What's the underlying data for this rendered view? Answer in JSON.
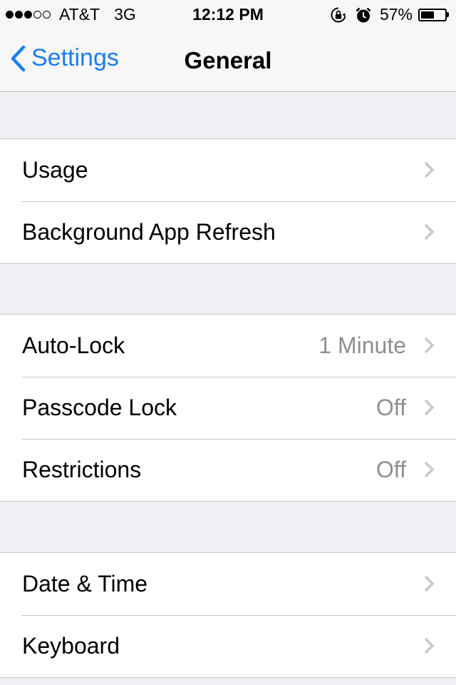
{
  "status_bar": {
    "signal_dots": [
      "full",
      "full",
      "full",
      "empty",
      "empty"
    ],
    "carrier": "AT&T",
    "network": "3G",
    "time": "12:12 PM",
    "icons": [
      "rotation-lock-icon",
      "alarm-icon"
    ],
    "battery_percent": "57%",
    "battery_level": 0.57
  },
  "nav": {
    "back_label": "Settings",
    "title": "General"
  },
  "groups": [
    {
      "rows": [
        {
          "label": "Usage",
          "value": ""
        },
        {
          "label": "Background App Refresh",
          "value": ""
        }
      ]
    },
    {
      "rows": [
        {
          "label": "Auto-Lock",
          "value": "1 Minute"
        },
        {
          "label": "Passcode Lock",
          "value": "Off"
        },
        {
          "label": "Restrictions",
          "value": "Off"
        }
      ]
    },
    {
      "rows": [
        {
          "label": "Date & Time",
          "value": ""
        },
        {
          "label": "Keyboard",
          "value": ""
        }
      ]
    }
  ],
  "colors": {
    "accent": "#1a7cf5",
    "background": "#efeff4",
    "secondary_text": "#8e8e93",
    "separator": "#c8c7cc",
    "chevron": "#c7c7cc"
  }
}
